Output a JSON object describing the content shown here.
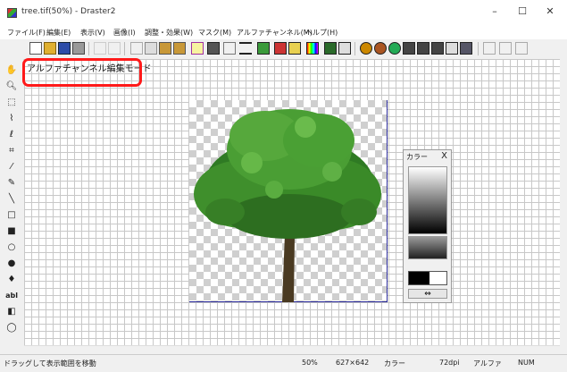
{
  "window": {
    "title": "tree.tif(50%) - Draster2",
    "minimize": "–",
    "maximize": "☐",
    "close": "✕"
  },
  "menu": [
    "ファイル(F)",
    "編集(E)",
    "表示(V)",
    "画像(I)",
    "調整・効果(W)",
    "マスク(M)",
    "アルファチャンネル(M)",
    "ヘルプ(H)"
  ],
  "canvas": {
    "mode_label": "アルファチャンネル編集モード"
  },
  "color_panel": {
    "title": "カラー",
    "close": "X",
    "swap": "⇔"
  },
  "status": {
    "hint": "ドラッグして表示範囲を移動",
    "zoom": "50%",
    "size": "627×642",
    "color": "カラー",
    "dpi": "72dpi",
    "channel": "アルファ",
    "numlock": "NUM"
  },
  "colors": {
    "highlight": "#ff1a1a",
    "image_border": "#2a2a9a",
    "tree_green": "#3f8f2c"
  }
}
